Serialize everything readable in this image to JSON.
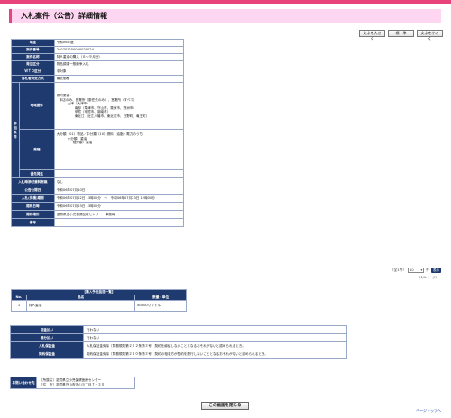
{
  "header": {
    "title": "入札案件（公告）詳細情報"
  },
  "font_controls": {
    "larger": "文字を大きく",
    "standard": "標　準",
    "smaller": "文字を小さく"
  },
  "detail": {
    "rows": [
      {
        "label": "年度",
        "value": "令和06年度"
      },
      {
        "label": "案件番号",
        "value": "240701250000020024"
      },
      {
        "label": "案件名称",
        "value": "特Ａ重油の購入（６～９月分）"
      },
      {
        "label": "発注区分",
        "value": "物品調達一般競争入札"
      },
      {
        "label": "ＷＴＯ区分",
        "value": "非対象"
      },
      {
        "label": "落札者決定方式",
        "value": "最低価格"
      }
    ],
    "participation": {
      "group_label": "参加条件",
      "region_label": "地域要件",
      "region_lines": [
        "県内業者：",
        "本店のみ、営業所（委任先のみ）、営業所（すべて）",
        "大津（大津市）",
        "南部（草津市、守山市、栗東市、野洲市）",
        "甲賀（甲賀市、湖南市）",
        "東近江（近江八幡市、東近江市、日野町、竜王町）"
      ],
      "category_label": "業種",
      "category_lines": [
        "大分類（01）物品／中分類（10）燃料・油脂・電力のうち",
        "小分類：重油",
        "細分類：重油"
      ],
      "priority_label": "優先発注",
      "priority_value": ""
    },
    "rows2": [
      {
        "label": "入札時添付資料有無",
        "value": "なし"
      },
      {
        "label": "公告公開日",
        "value": "令和06年07月10日"
      },
      {
        "label": "入札(見積)期間",
        "value": "令和06年07月22日 13時00分　～　令和06年07月23日 12時00分"
      },
      {
        "label": "開札日時",
        "value": "令和06年07月23日 13時00分"
      },
      {
        "label": "開札場所",
        "value": "滋賀県立小児保健医療センター　事務局"
      },
      {
        "label": "備考",
        "value": ""
      }
    ]
  },
  "pager": {
    "total": "（全1件）",
    "per_page": "10",
    "unit": "件",
    "go": "表示",
    "note": "（1/1ページ）"
  },
  "items": {
    "caption": "【購入予定品目一覧】",
    "headers": {
      "no": "No.",
      "name": "品名",
      "qty": "数量・単位"
    },
    "rows": [
      {
        "no": "1",
        "name": "特Ａ重油",
        "qty": "80000リットル"
      }
    ]
  },
  "terms": [
    {
      "label": "前金払い",
      "value": "行わない"
    },
    {
      "label": "部分払い",
      "value": "行わない"
    },
    {
      "label": "入札保証金",
      "value": "入札保証金免除［財務規則第２０２条第３号］契約を締結しないこととなるおそれがないと認められるとき。"
    },
    {
      "label": "契約保証金",
      "value": "契約保証金免除［財務規則第２３０条第３号］契約の相手方が契約を履行しないこととなるおそれがないと認められるとき。"
    }
  ],
  "contact": {
    "label": "お問い合わせ先",
    "lines": [
      "［所属名］滋賀県立小児保健医療センター",
      "［住　所］滋賀県守山市守山５丁目７－３０"
    ]
  },
  "footer": {
    "close": "この画面を閉じる",
    "page_top": "ページトップへ"
  }
}
